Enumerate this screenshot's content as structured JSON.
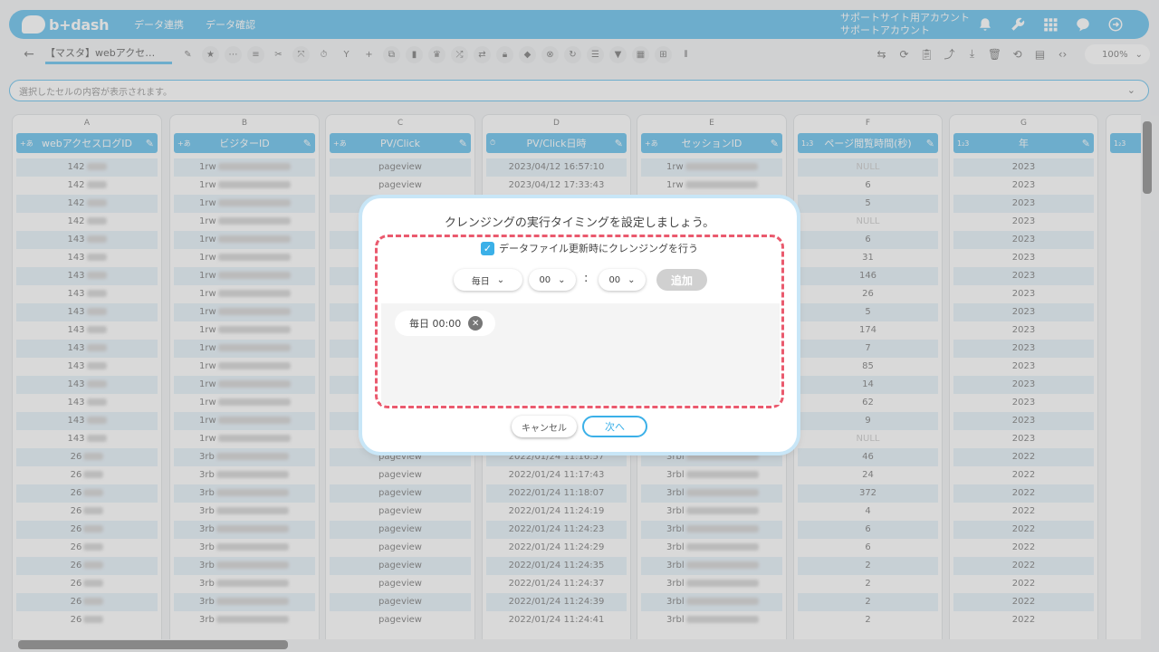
{
  "header": {
    "logo_text": "b+dash",
    "nav": [
      "データ連携",
      "データ確認"
    ],
    "account_line1": "サポートサイト用アカウント",
    "account_line2": "サポートアカウント"
  },
  "toolbar": {
    "sheet_name": "【マスタ】webアクセ…",
    "zoom": "100%"
  },
  "formula_bar": {
    "placeholder": "選択したセルの内容が表示されます。"
  },
  "columns": [
    {
      "letter": "A",
      "header": "webアクセスログID",
      "type_icon": "text-type-icon",
      "cells": [
        "142",
        "142",
        "142",
        "142",
        "143",
        "143",
        "143",
        "143",
        "143",
        "143",
        "143",
        "143",
        "143",
        "143",
        "143",
        "143",
        "26",
        "26",
        "26",
        "26",
        "26",
        "26",
        "26",
        "26",
        "26",
        "26"
      ],
      "partial": true,
      "align": "center"
    },
    {
      "letter": "B",
      "header": "ビジターID",
      "type_icon": "text-type-icon",
      "cells": [
        "1rw",
        "1rw",
        "1rw",
        "1rw",
        "1rw",
        "1rw",
        "1rw",
        "1rw",
        "1rw",
        "1rw",
        "1rw",
        "1rw",
        "1rw",
        "1rw",
        "1rw",
        "1rw",
        "3rb",
        "3rb",
        "3rb",
        "3rb",
        "3rb",
        "3rb",
        "3rb",
        "3rb",
        "3rb",
        "3rb"
      ],
      "partial": true,
      "align": "left"
    },
    {
      "letter": "C",
      "header": "PV/Click",
      "type_icon": "text-type-icon",
      "cells": [
        "pageview",
        "pageview",
        "",
        "",
        "",
        "",
        "",
        "",
        "",
        "",
        "",
        "",
        "",
        "",
        "",
        "",
        "pageview",
        "pageview",
        "pageview",
        "pageview",
        "pageview",
        "pageview",
        "pageview",
        "pageview",
        "pageview",
        "pageview"
      ],
      "partial": false,
      "align": "center"
    },
    {
      "letter": "D",
      "header": "PV/Click日時",
      "type_icon": "datetime-type-icon",
      "cells": [
        "2023/04/12 16:57:10",
        "2023/04/12 17:33:43",
        "",
        "",
        "",
        "",
        "",
        "",
        "",
        "",
        "",
        "",
        "",
        "",
        "",
        "",
        "2022/01/24 11:16:57",
        "2022/01/24 11:17:43",
        "2022/01/24 11:18:07",
        "2022/01/24 11:24:19",
        "2022/01/24 11:24:23",
        "2022/01/24 11:24:29",
        "2022/01/24 11:24:35",
        "2022/01/24 11:24:37",
        "2022/01/24 11:24:39",
        "2022/01/24 11:24:41"
      ],
      "partial": false,
      "align": "center"
    },
    {
      "letter": "E",
      "header": "セッションID",
      "type_icon": "text-type-icon",
      "cells": [
        "1rw",
        "1rw",
        "",
        "",
        "",
        "",
        "",
        "",
        "",
        "",
        "",
        "",
        "",
        "",
        "",
        "",
        "3rbl",
        "3rbl",
        "3rbl",
        "3rbl",
        "3rbl",
        "3rbl",
        "3rbl",
        "3rbl",
        "3rbl",
        "3rbl"
      ],
      "partial": true,
      "align": "left"
    },
    {
      "letter": "F",
      "header": "ページ閲覧時間(秒)",
      "type_icon": "number-type-icon",
      "cells": [
        "NULL",
        "6",
        "5",
        "NULL",
        "6",
        "31",
        "146",
        "26",
        "5",
        "174",
        "7",
        "85",
        "14",
        "62",
        "9",
        "NULL",
        "46",
        "24",
        "372",
        "4",
        "6",
        "6",
        "2",
        "2",
        "2",
        "2"
      ],
      "partial": false,
      "align": "center"
    },
    {
      "letter": "G",
      "header": "年",
      "type_icon": "number-type-icon",
      "cells": [
        "2023",
        "2023",
        "2023",
        "2023",
        "2023",
        "2023",
        "2023",
        "2023",
        "2023",
        "2023",
        "2023",
        "2023",
        "2023",
        "2023",
        "2023",
        "2023",
        "2022",
        "2022",
        "2022",
        "2022",
        "2022",
        "2022",
        "2022",
        "2022",
        "2022",
        "2022"
      ],
      "partial": false,
      "align": "center"
    },
    {
      "letter": "",
      "header": "",
      "type_icon": "number-type-icon",
      "cells": [],
      "partial": false,
      "align": "center"
    }
  ],
  "modal": {
    "title": "クレンジングの実行タイミングを設定しましょう。",
    "checkbox_label": "データファイル更新時にクレンジングを行う",
    "frequency": "毎日",
    "hour": "00",
    "minute": "00",
    "add_label": "追加",
    "schedules": [
      "毎日 00:00"
    ],
    "cancel_label": "キャンセル",
    "next_label": "次へ"
  }
}
